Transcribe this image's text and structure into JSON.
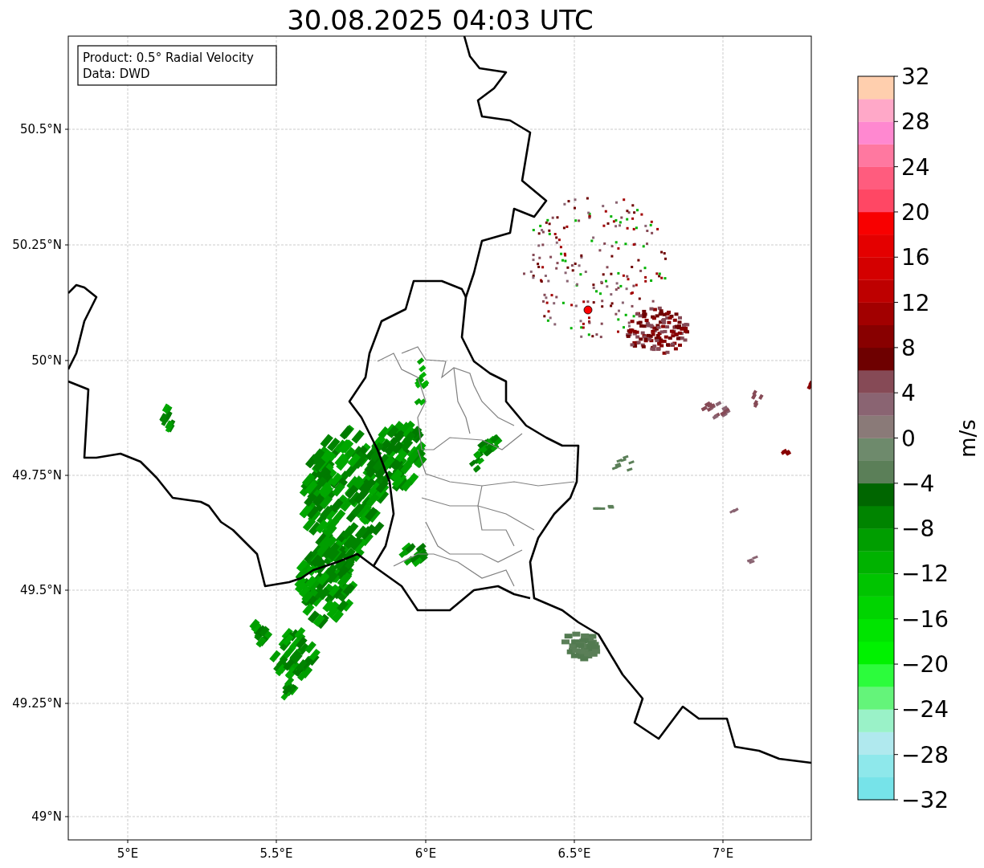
{
  "title": "30.08.2025 04:03 UTC",
  "info_box": [
    "Product: 0.5° Radial Velocity",
    "Data: DWD"
  ],
  "map": {
    "xticks": [
      "5°E",
      "5.5°E",
      "6°E",
      "6.5°E",
      "7°E"
    ],
    "yticks": [
      "50.5°N",
      "50.25°N",
      "50°N",
      "49.75°N",
      "49.5°N",
      "49.25°N",
      "49°N"
    ]
  },
  "colorbar": {
    "label": "m/s",
    "ticks": [
      "32",
      "28",
      "24",
      "20",
      "16",
      "12",
      "8",
      "4",
      "0",
      "−4",
      "−8",
      "−12",
      "−16",
      "−20",
      "−24",
      "−28",
      "−32"
    ],
    "bins": [
      {
        "color": "#76e3e9"
      },
      {
        "color": "#8ee8eb"
      },
      {
        "color": "#b0e9ee"
      },
      {
        "color": "#9af2c8"
      },
      {
        "color": "#64f47a"
      },
      {
        "color": "#2cfc3c"
      },
      {
        "color": "#00f200"
      },
      {
        "color": "#00e400"
      },
      {
        "color": "#00d400"
      },
      {
        "color": "#00c400"
      },
      {
        "color": "#00b200"
      },
      {
        "color": "#009e00"
      },
      {
        "color": "#008400"
      },
      {
        "color": "#006600"
      },
      {
        "color": "#5b7f58"
      },
      {
        "color": "#6e8a6c"
      },
      {
        "color": "#8a7a78"
      },
      {
        "color": "#8a6472"
      },
      {
        "color": "#864a56"
      },
      {
        "color": "#6e0000"
      },
      {
        "color": "#880000"
      },
      {
        "color": "#a20000"
      },
      {
        "color": "#be0000"
      },
      {
        "color": "#d40000"
      },
      {
        "color": "#e40000"
      },
      {
        "color": "#f80000"
      },
      {
        "color": "#ff4764"
      },
      {
        "color": "#ff5c7e"
      },
      {
        "color": "#ff78a0"
      },
      {
        "color": "#ff88d0"
      },
      {
        "color": "#ffa8c8"
      },
      {
        "color": "#ffcfae"
      }
    ]
  }
}
